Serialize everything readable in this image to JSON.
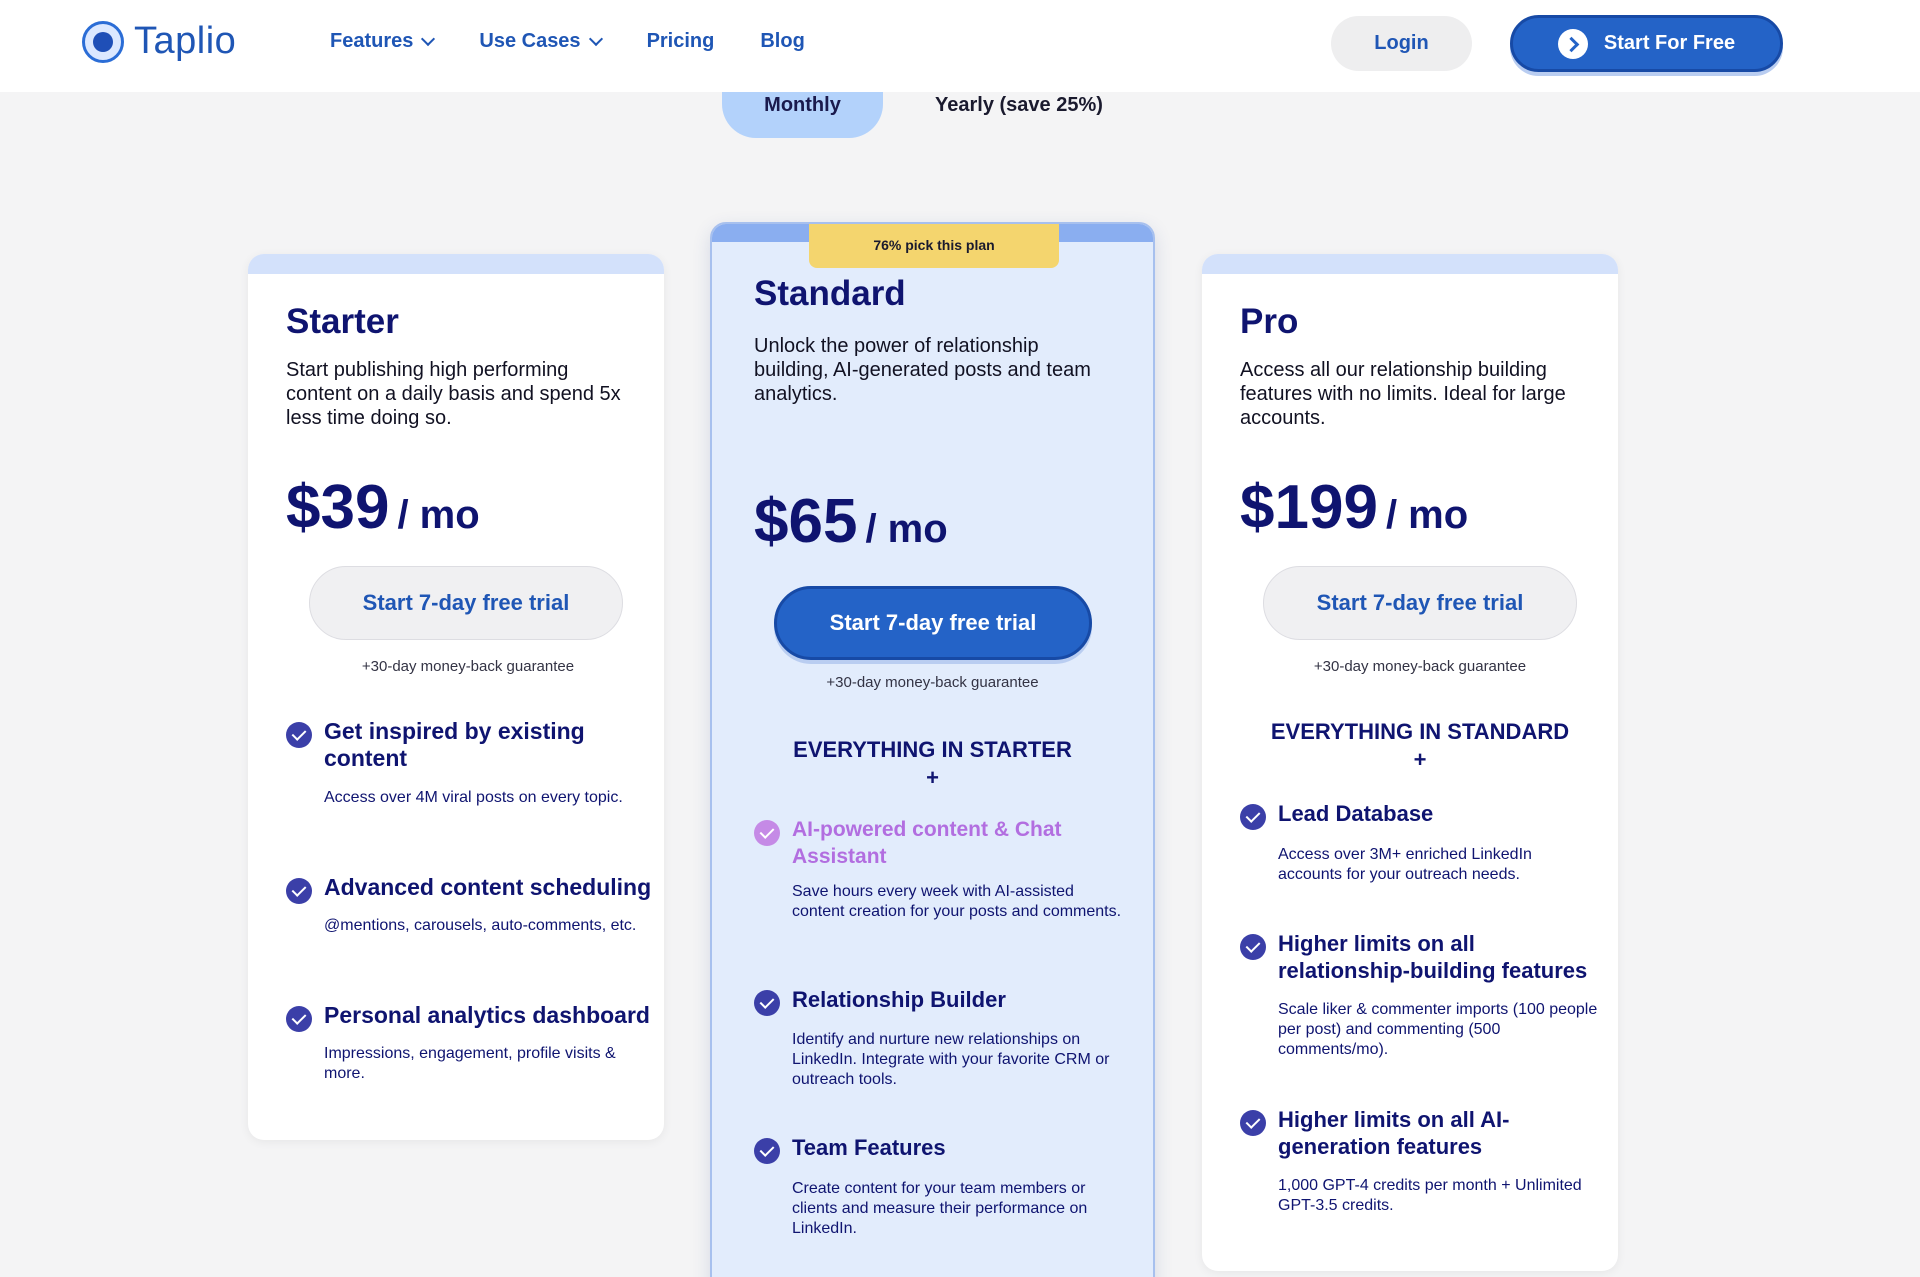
{
  "nav": {
    "logo_text": "Taplio",
    "items": [
      {
        "label": "Features",
        "has_dropdown": true
      },
      {
        "label": "Use Cases",
        "has_dropdown": true
      },
      {
        "label": "Pricing",
        "has_dropdown": false
      },
      {
        "label": "Blog",
        "has_dropdown": false
      }
    ],
    "login_label": "Login",
    "cta_label": "Start For Free"
  },
  "billing_toggle": {
    "monthly_label": "Monthly",
    "yearly_label": "Yearly (save 25%)",
    "selected": "Monthly"
  },
  "colors": {
    "brand_blue": "#2463c7",
    "navy_text": "#0f1470",
    "badge_yellow": "#f4d56e",
    "standard_card_bg": "#e2ecfc",
    "ai_feature_pink": "#b26ee0"
  },
  "plans": [
    {
      "name": "Starter",
      "description": "Start publishing high performing content on a daily basis and spend 5x less time doing so.",
      "price": "$39",
      "period": "/ mo",
      "trial_label": "Start 7-day free trial",
      "guarantee": "+30-day money-back guarantee",
      "features": [
        {
          "title": "Get inspired by existing content",
          "desc": "Access over 4M viral posts on every topic."
        },
        {
          "title": "Advanced content scheduling",
          "desc": "@mentions, carousels, auto-comments, etc."
        },
        {
          "title": "Personal analytics dashboard",
          "desc": "Impressions, engagement, profile visits & more."
        }
      ]
    },
    {
      "name": "Standard",
      "badge": "76% pick this plan",
      "description": "Unlock the power of relationship building, AI-generated posts and team analytics.",
      "price": "$65",
      "period": "/ mo",
      "trial_label": "Start 7-day free trial",
      "guarantee": "+30-day money-back guarantee",
      "everything_label": "EVERYTHING IN STARTER",
      "plus": "+",
      "features": [
        {
          "title": "AI-powered content & Chat Assistant",
          "desc": "Save hours every week with AI-assisted content creation for your posts and comments."
        },
        {
          "title": "Relationship Builder",
          "desc": "Identify and nurture new relationships on LinkedIn. Integrate with your favorite CRM or outreach tools."
        },
        {
          "title": "Team Features",
          "desc": "Create content for your team members or clients and measure their performance on LinkedIn."
        }
      ]
    },
    {
      "name": "Pro",
      "description": "Access all our relationship building features with no limits. Ideal for large accounts.",
      "price": "$199",
      "period": "/ mo",
      "trial_label": "Start 7-day free trial",
      "guarantee": "+30-day money-back guarantee",
      "everything_label": "EVERYTHING IN STANDARD",
      "plus": "+",
      "features": [
        {
          "title": "Lead Database",
          "desc": "Access over 3M+ enriched LinkedIn accounts for your outreach needs."
        },
        {
          "title": "Higher limits on all relationship-building features",
          "desc": "Scale liker & commenter imports (100 people per post) and commenting (500 comments/mo)."
        },
        {
          "title": "Higher limits on all AI-generation features",
          "desc": "1,000 GPT-4 credits per month + Unlimited GPT-3.5 credits."
        }
      ]
    }
  ]
}
